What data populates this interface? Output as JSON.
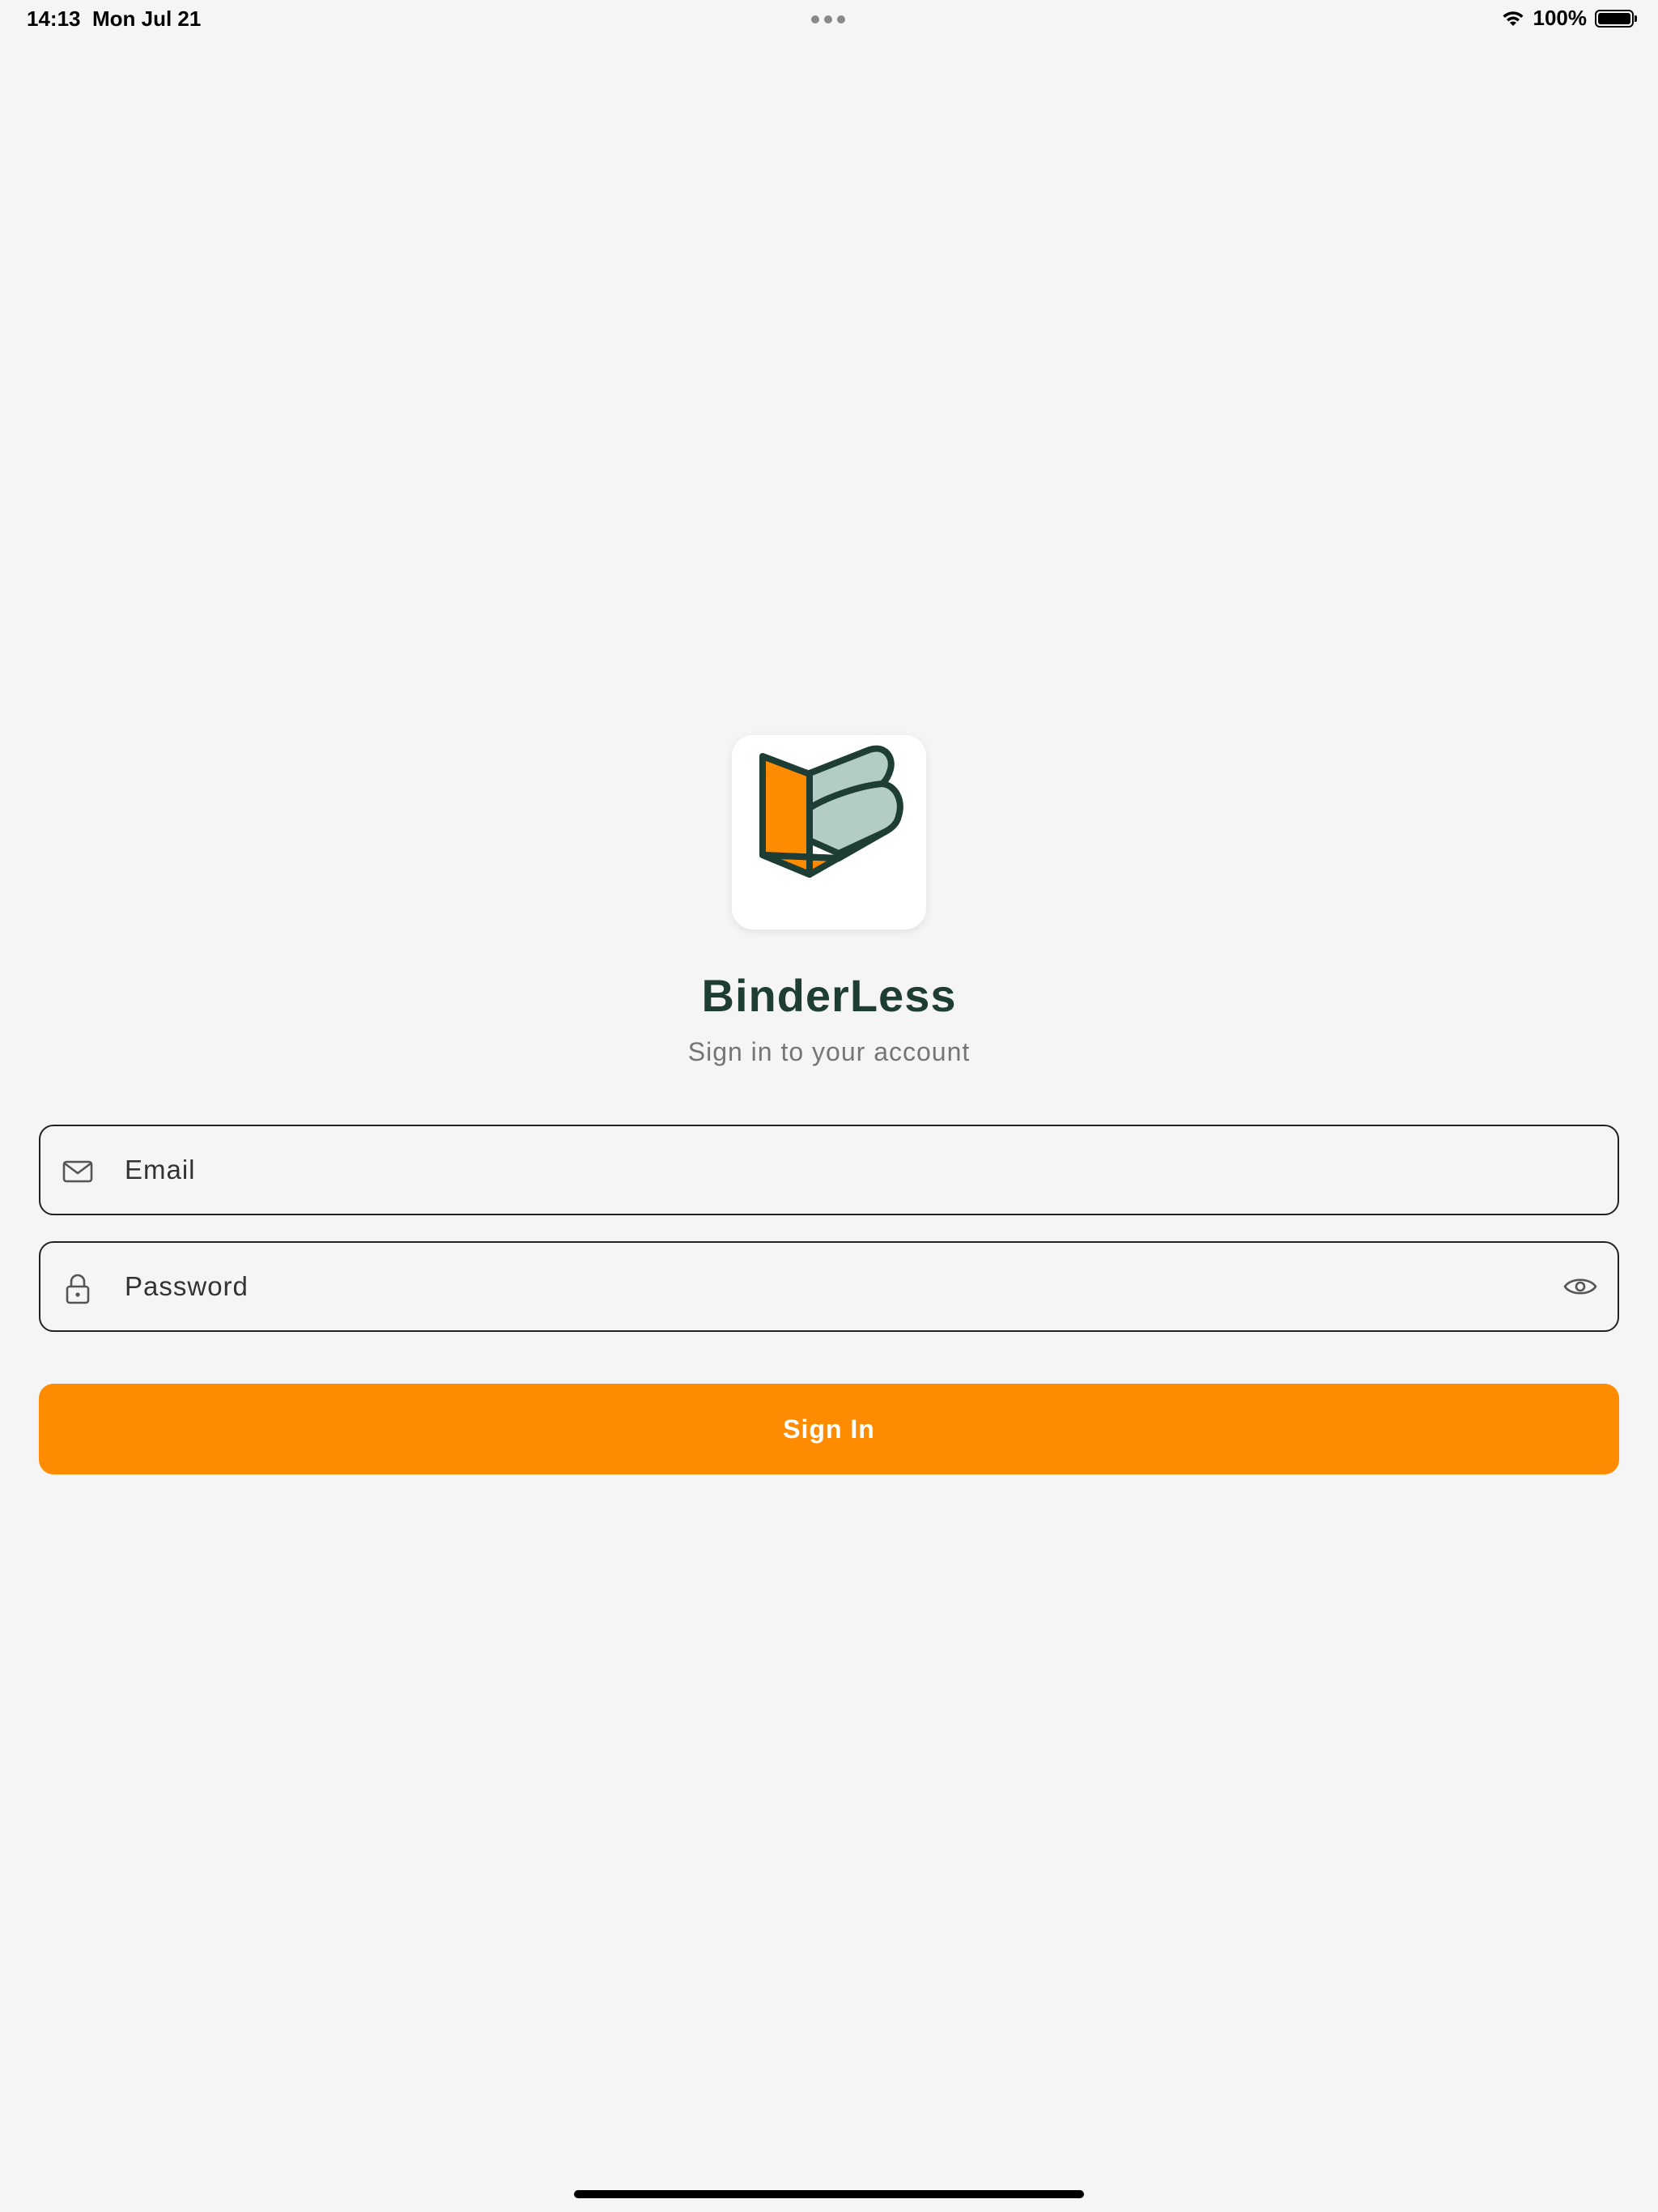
{
  "status_bar": {
    "time": "14:13",
    "date": "Mon Jul 21",
    "battery": "100%"
  },
  "app": {
    "title": "BinderLess",
    "subtitle": "Sign in to your account"
  },
  "form": {
    "email": {
      "placeholder": "Email",
      "value": "",
      "icon": "mail-icon"
    },
    "password": {
      "placeholder": "Password",
      "value": "",
      "icon": "lock-icon",
      "toggle_icon": "eye-icon"
    },
    "sign_in_label": "Sign In"
  },
  "colors": {
    "accent": "#ff8c00",
    "brand_dark": "#1e3d34",
    "logo_sage": "#b3ccc5",
    "background": "#f5f5f5"
  }
}
